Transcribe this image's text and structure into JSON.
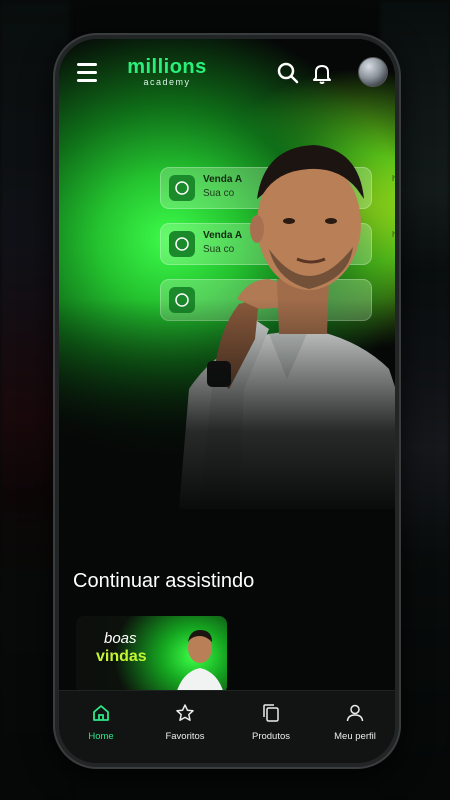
{
  "app": {
    "logo_main": "millions",
    "logo_sub": "academy"
  },
  "header": {
    "menu_icon": "hamburger-menu-icon",
    "search_icon": "search-icon",
    "notification_icon": "bell-icon",
    "avatar": "user-avatar"
  },
  "hero": {
    "notifications": [
      {
        "title": "Venda A",
        "subtitle": "Sua co",
        "time": "há"
      },
      {
        "title": "Venda A",
        "subtitle": "Sua co",
        "time": "há"
      },
      {
        "title": "",
        "subtitle": "",
        "time": ""
      }
    ]
  },
  "continue_watching": {
    "title": "Continuar assistindo",
    "items": [
      {
        "line1": "boas",
        "line2": "vindas"
      }
    ]
  },
  "bottom_nav": {
    "items": [
      {
        "label": "Home",
        "icon": "home-icon",
        "active": true
      },
      {
        "label": "Favoritos",
        "icon": "star-icon",
        "active": false
      },
      {
        "label": "Produtos",
        "icon": "copy-icon",
        "active": false
      },
      {
        "label": "Meu perfil",
        "icon": "user-icon",
        "active": false
      }
    ]
  },
  "colors": {
    "accent": "#2ee889",
    "brand_green": "#29f07b",
    "background": "#060807"
  }
}
